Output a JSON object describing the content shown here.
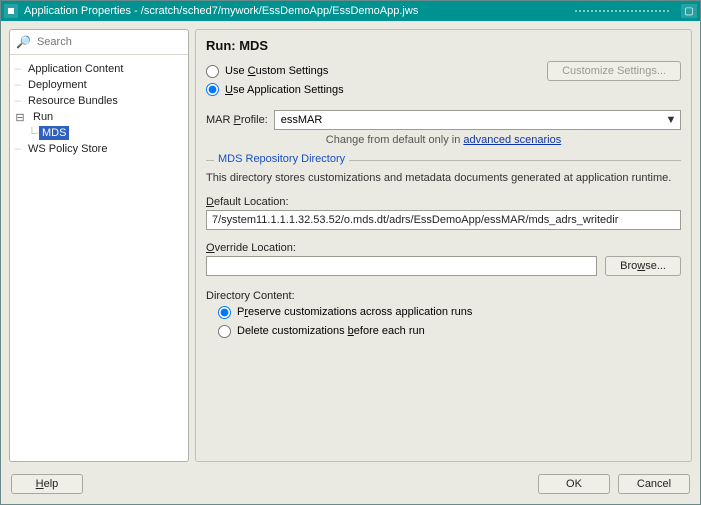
{
  "title": "Application Properties - /scratch/sched7/mywork/EssDemoApp/EssDemoApp.jws",
  "search_placeholder": "Search",
  "tree": {
    "app_content": "Application Content",
    "deployment": "Deployment",
    "resource_bundles": "Resource Bundles",
    "run": "Run",
    "mds": "MDS",
    "ws_policy": "WS Policy Store"
  },
  "panel": {
    "heading": "Run: MDS",
    "use_custom_pre": "Use ",
    "use_custom_u": "C",
    "use_custom_post": "ustom Settings",
    "use_app_pre": "",
    "use_app_u": "U",
    "use_app_post": "se Application Settings",
    "customize_btn": "Customize Settings...",
    "mar_label_pre": "MAR ",
    "mar_label_u": "P",
    "mar_label_post": "rofile:",
    "mar_value": "essMAR",
    "change_hint_pre": "Change from default only in ",
    "change_hint_link": "advanced scenarios",
    "group_legend": "MDS Repository Directory",
    "group_desc": "This directory stores customizations and metadata documents generated at application runtime.",
    "default_loc_pre": "",
    "default_loc_u": "D",
    "default_loc_post": "efault Location:",
    "default_path": "7/system11.1.1.1.32.53.52/o.mds.dt/adrs/EssDemoApp/essMAR/mds_adrs_writedir",
    "override_loc_pre": "",
    "override_loc_u": "O",
    "override_loc_post": "verride Location:",
    "override_value": "",
    "browse_pre": "Bro",
    "browse_u": "w",
    "browse_post": "se...",
    "dir_content_label": "Directory Content:",
    "preserve_pre": "P",
    "preserve_u": "r",
    "preserve_post": "eserve customizations across application runs",
    "delete_pre": "Delete customizations ",
    "delete_u": "b",
    "delete_post": "efore each run"
  },
  "buttons": {
    "help": "Help",
    "ok": "OK",
    "cancel": "Cancel"
  }
}
